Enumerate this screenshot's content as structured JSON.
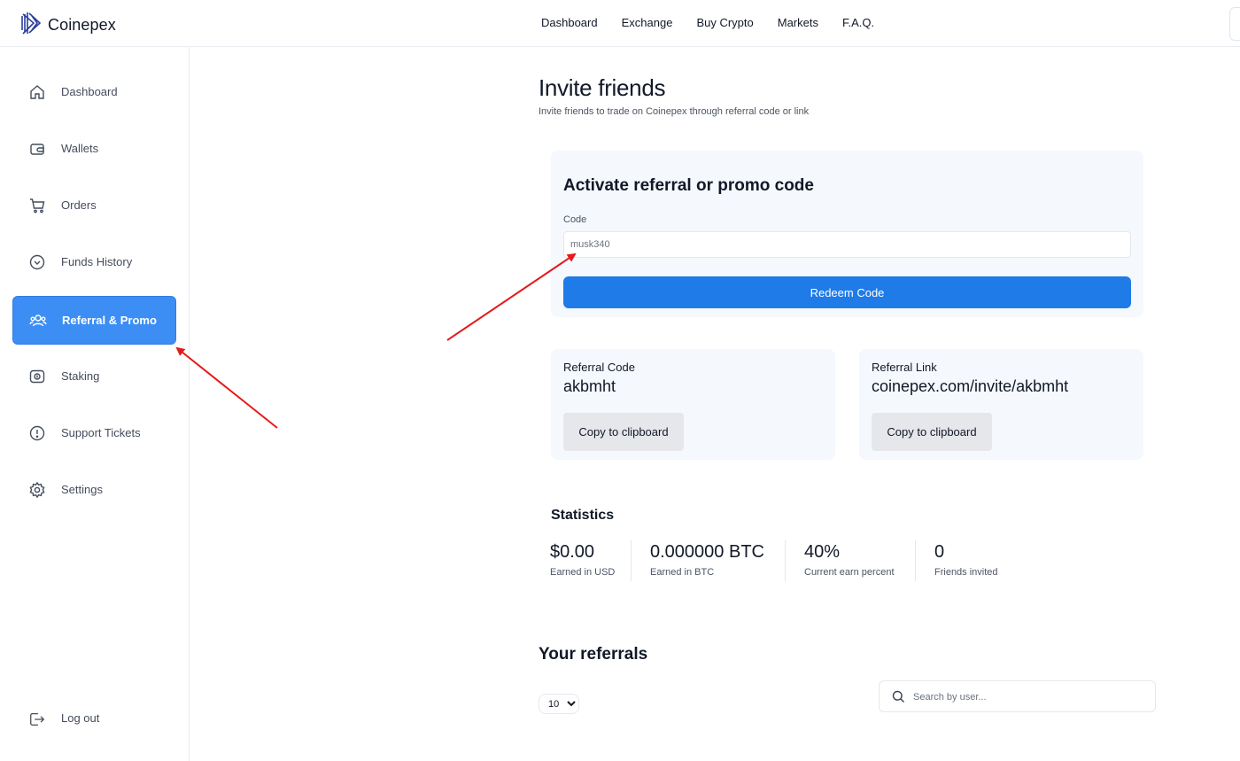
{
  "brand": {
    "name": "Coinepex"
  },
  "topnav": [
    "Dashboard",
    "Exchange",
    "Buy Crypto",
    "Markets",
    "F.A.Q."
  ],
  "sidebar": {
    "items": [
      {
        "label": "Dashboard",
        "icon": "home-icon"
      },
      {
        "label": "Wallets",
        "icon": "wallet-icon"
      },
      {
        "label": "Orders",
        "icon": "cart-icon"
      },
      {
        "label": "Funds History",
        "icon": "history-icon"
      },
      {
        "label": "Referral & Promo",
        "icon": "users-icon",
        "active": true
      },
      {
        "label": "Staking",
        "icon": "staking-icon"
      },
      {
        "label": "Support Tickets",
        "icon": "alert-icon"
      },
      {
        "label": "Settings",
        "icon": "gear-icon"
      }
    ],
    "logout": {
      "label": "Log out",
      "icon": "logout-icon"
    }
  },
  "main": {
    "title": "Invite friends",
    "subtitle": "Invite friends to trade on Coinepex through referral code or link",
    "promo": {
      "title": "Activate referral or promo code",
      "code_label": "Code",
      "code_value": "musk340",
      "redeem_label": "Redeem Code"
    },
    "referral_code": {
      "label": "Referral Code",
      "value": "akbmht",
      "copy_label": "Copy to clipboard"
    },
    "referral_link": {
      "label": "Referral Link",
      "value": "coinepex.com/invite/akbmht",
      "copy_label": "Copy to clipboard"
    },
    "statistics": {
      "title": "Statistics",
      "items": [
        {
          "value": "$0.00",
          "label": "Earned in USD"
        },
        {
          "value": "0.000000 BTC",
          "label": "Earned in BTC"
        },
        {
          "value": "40%",
          "label": "Current earn percent"
        },
        {
          "value": "0",
          "label": "Friends invited"
        }
      ]
    },
    "referrals": {
      "title": "Your referrals",
      "page_size": "10",
      "search_placeholder": "Search by user..."
    }
  },
  "colors": {
    "accent": "#1e7be8",
    "active_sidebar": "#3c8ef5",
    "card_bg": "#f5f8fc",
    "arrow": "#e31b1b"
  }
}
